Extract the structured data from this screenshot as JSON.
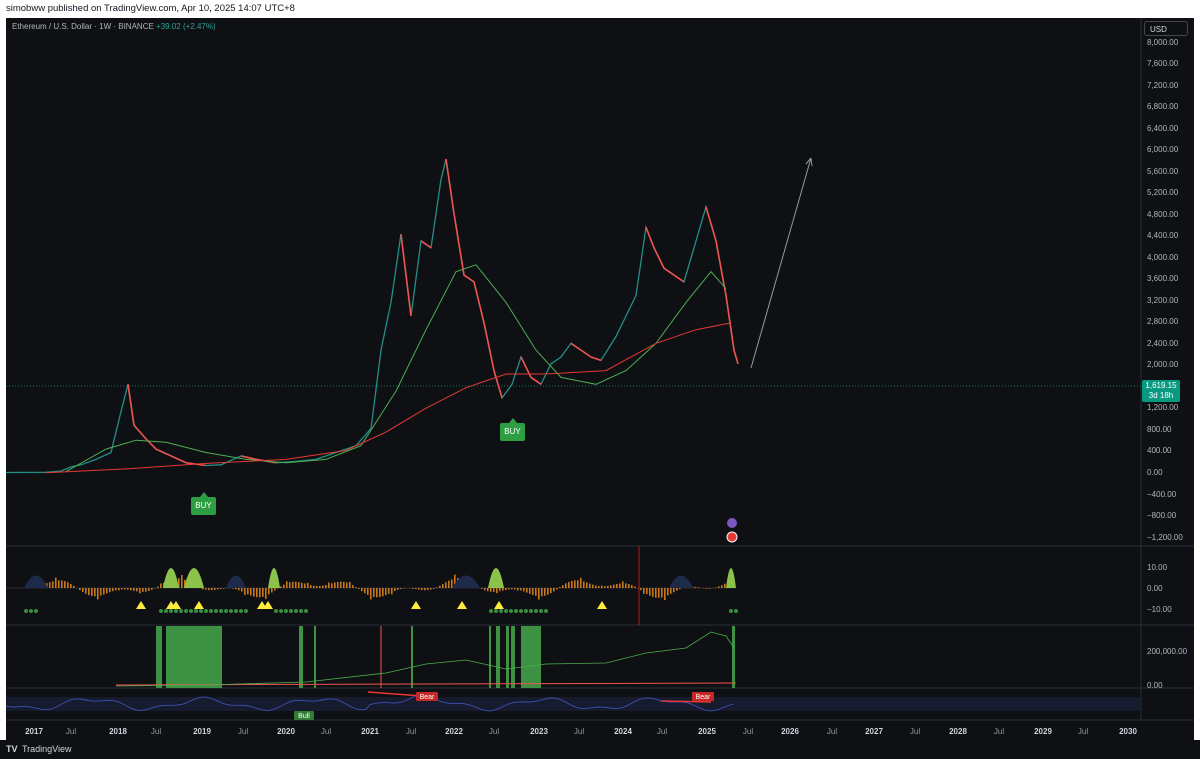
{
  "header": {
    "published_text": "simobww published on TradingView.com, Apr 10, 2025 14:07 UTC+8"
  },
  "symbol": {
    "title": "Ethereum / U.S. Dollar · 1W · BINANCE",
    "change": "+39.02 (+2.47%)"
  },
  "currency": "USD",
  "current_price": {
    "value": "1,619.15",
    "countdown": "3d 18h"
  },
  "colors": {
    "bull": "#26a69a",
    "bear": "#ef5350",
    "sma_slow": "#e53935",
    "sma_fast": "#4caf50",
    "buy": "#2e9e44",
    "background": "#0f1014"
  },
  "signals": {
    "buy_label": "BUY"
  },
  "price_axis": [
    "8,000.00",
    "7,600.00",
    "7,200.00",
    "6,800.00",
    "6,400.00",
    "6,000.00",
    "5,600.00",
    "5,200.00",
    "4,800.00",
    "4,400.00",
    "4,000.00",
    "3,600.00",
    "3,200.00",
    "2,800.00",
    "2,400.00",
    "2,000.00",
    "1,200.00",
    "800.00",
    "400.00",
    "0.00",
    "−400.00",
    "−800.00",
    "−1,200.00"
  ],
  "indicator1_axis": [
    "10.00",
    "0.00",
    "−10.00"
  ],
  "indicator2_axis": [
    "200,000.00",
    "0.00"
  ],
  "rsi_tags": {
    "bull": "Bull",
    "bear": "Bear"
  },
  "time_axis": [
    {
      "label": "2017",
      "type": "year"
    },
    {
      "label": "Jul",
      "type": "month"
    },
    {
      "label": "2018",
      "type": "year"
    },
    {
      "label": "Jul",
      "type": "month"
    },
    {
      "label": "2019",
      "type": "year"
    },
    {
      "label": "Jul",
      "type": "month"
    },
    {
      "label": "2020",
      "type": "year"
    },
    {
      "label": "Jul",
      "type": "month"
    },
    {
      "label": "2021",
      "type": "year"
    },
    {
      "label": "Jul",
      "type": "month"
    },
    {
      "label": "2022",
      "type": "year"
    },
    {
      "label": "Jul",
      "type": "month"
    },
    {
      "label": "2023",
      "type": "year"
    },
    {
      "label": "Jul",
      "type": "month"
    },
    {
      "label": "2024",
      "type": "year"
    },
    {
      "label": "Jul",
      "type": "month"
    },
    {
      "label": "2025",
      "type": "year"
    },
    {
      "label": "Jul",
      "type": "month"
    },
    {
      "label": "2026",
      "type": "year"
    },
    {
      "label": "Jul",
      "type": "month"
    },
    {
      "label": "2027",
      "type": "year"
    },
    {
      "label": "Jul",
      "type": "month"
    },
    {
      "label": "2028",
      "type": "year"
    },
    {
      "label": "Jul",
      "type": "month"
    },
    {
      "label": "2029",
      "type": "year"
    },
    {
      "label": "Jul",
      "type": "month"
    },
    {
      "label": "2030",
      "type": "year"
    }
  ],
  "footer": {
    "brand": "TradingView",
    "logo": "TV"
  }
}
